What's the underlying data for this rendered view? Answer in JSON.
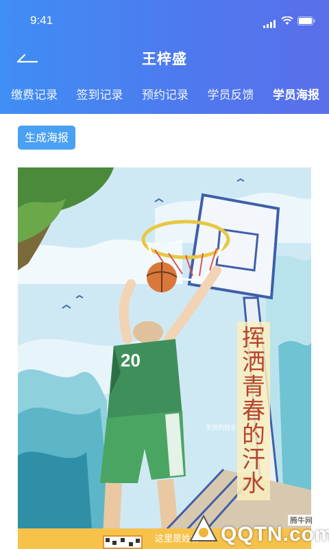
{
  "status_bar": {
    "time": "9:41"
  },
  "nav": {
    "title": "王梓盛",
    "back_icon": "back-arrow-icon"
  },
  "tabs": [
    {
      "label": "缴费记录",
      "active": false
    },
    {
      "label": "签到记录",
      "active": false
    },
    {
      "label": "预约记录",
      "active": false
    },
    {
      "label": "学员反馈",
      "active": false
    },
    {
      "label": "学员海报",
      "active": true
    }
  ],
  "actions": {
    "generate_poster_label": "生成海报"
  },
  "poster": {
    "jersey_number": "20",
    "slogan": [
      "挥",
      "洒",
      "青",
      "春",
      "的",
      "汗",
      "水"
    ],
    "player_name_placeholder": "学员的姓名",
    "bottom_label": "这里是姓名"
  },
  "watermark": {
    "badge": "腾牛网",
    "text": "QQTN.com"
  },
  "colors": {
    "header_start": "#3f8ef4",
    "header_end": "#5a6fea",
    "button": "#4aa0f2",
    "slogan_text": "#b6452f"
  }
}
